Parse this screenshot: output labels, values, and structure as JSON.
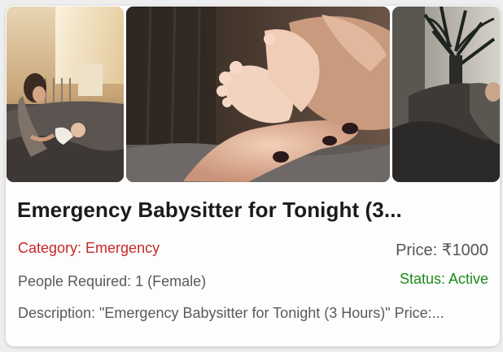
{
  "listing": {
    "title": "Emergency Babysitter for Tonight (3...",
    "category": "Category: Emergency",
    "price": "Price: ₹1000",
    "people_required": "People Required: 1 (Female)",
    "status": "Status: Active",
    "description": "Description: \"Emergency Babysitter for Tonight (3 Hours)\" Price:..."
  },
  "gallery": {
    "photos": [
      {
        "icon": "mother-with-baby-photo"
      },
      {
        "icon": "baby-feet-photo"
      },
      {
        "icon": "mother-holding-baby-photo"
      }
    ]
  },
  "colors": {
    "category": "#c62828",
    "status": "#1b8a1b",
    "title": "#1b1b1b",
    "muted_text": "#5a5a5a"
  }
}
